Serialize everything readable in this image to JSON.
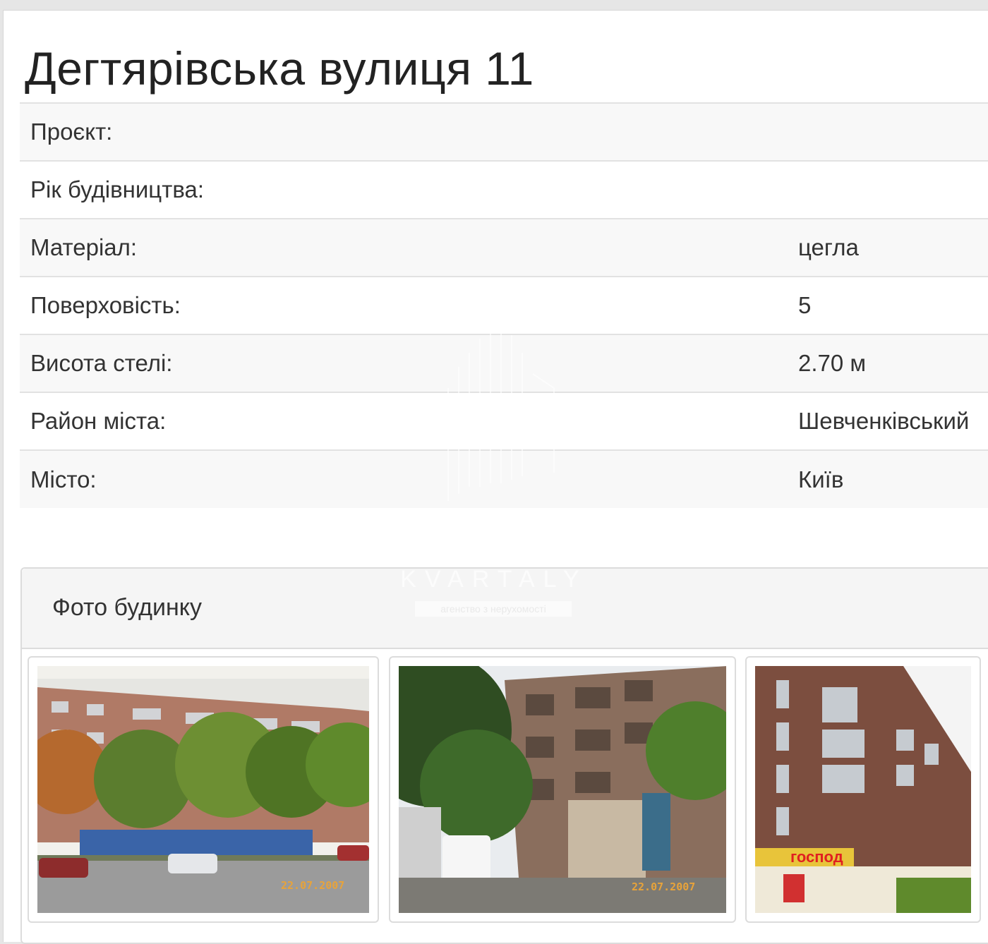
{
  "header": {
    "title": "Дегтярівська вулиця 11"
  },
  "specs": [
    {
      "label": "Проєкт:",
      "value": ""
    },
    {
      "label": "Рік будівництва:",
      "value": ""
    },
    {
      "label": "Матеріал:",
      "value": "цегла"
    },
    {
      "label": "Поверховість:",
      "value": "5"
    },
    {
      "label": "Висота стелі:",
      "value": "2.70 м"
    },
    {
      "label": "Район міста:",
      "value": "Шевченківський"
    },
    {
      "label": "Місто:",
      "value": "Київ"
    }
  ],
  "watermark": {
    "brand": "KVARTALY",
    "tagline": "агенство з нерухомості"
  },
  "photos": {
    "heading": "Фото будинку",
    "items": [
      {
        "date_stamp": "22.07.2007",
        "sign": ""
      },
      {
        "date_stamp": "22.07.2007",
        "sign": ""
      },
      {
        "date_stamp": "",
        "sign": "господ"
      }
    ]
  }
}
